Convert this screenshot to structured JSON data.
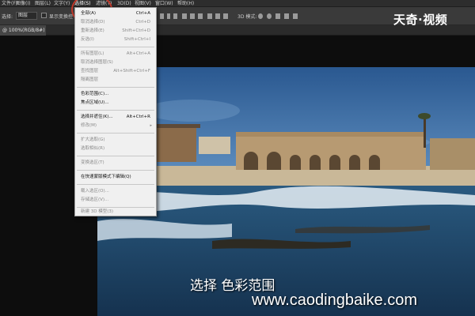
{
  "menubar": {
    "items": [
      "文件(F)",
      "图像(I)",
      "图层(L)",
      "文字(Y)",
      "选择(S)",
      "滤镜(T)",
      "3D(D)",
      "视图(V)",
      "窗口(W)",
      "帮助(H)"
    ]
  },
  "options_bar": {
    "select_label": "选择:",
    "layer_value": "图层",
    "checkbox_label": "显示变换控件",
    "mode_3d_label": "3D 模式:"
  },
  "tab": {
    "label": "@ 100%(RGB/8#)"
  },
  "select_menu": {
    "items": [
      {
        "label": "全部(A)",
        "shortcut": "Ctrl+A",
        "enabled": true
      },
      {
        "label": "取消选择(D)",
        "shortcut": "Ctrl+D",
        "enabled": false
      },
      {
        "label": "重新选择(E)",
        "shortcut": "Shift+Ctrl+D",
        "enabled": false
      },
      {
        "label": "反选(I)",
        "shortcut": "Shift+Ctrl+I",
        "enabled": false
      },
      {
        "label": "所有图层(L)",
        "shortcut": "Alt+Ctrl+A",
        "enabled": false
      },
      {
        "label": "取消选择图层(S)",
        "shortcut": "",
        "enabled": false
      },
      {
        "label": "查找图层",
        "shortcut": "Alt+Shift+Ctrl+F",
        "enabled": false
      },
      {
        "label": "隔离图层",
        "shortcut": "",
        "enabled": false
      },
      {
        "label": "色彩范围(C)...",
        "shortcut": "",
        "enabled": true
      },
      {
        "label": "焦点区域(U)...",
        "shortcut": "",
        "enabled": true
      },
      {
        "label": "选择并遮住(K)...",
        "shortcut": "Alt+Ctrl+R",
        "enabled": true
      },
      {
        "label": "修改(M)",
        "shortcut": "",
        "enabled": false,
        "submenu": true
      },
      {
        "label": "扩大选取(G)",
        "shortcut": "",
        "enabled": false
      },
      {
        "label": "选取相似(R)",
        "shortcut": "",
        "enabled": false
      },
      {
        "label": "变换选区(T)",
        "shortcut": "",
        "enabled": false
      },
      {
        "label": "在快速蒙版模式下编辑(Q)",
        "shortcut": "",
        "enabled": true
      },
      {
        "label": "载入选区(O)...",
        "shortcut": "",
        "enabled": false
      },
      {
        "label": "存储选区(V)...",
        "shortcut": "",
        "enabled": false
      },
      {
        "label": "新建 3D 模型(3)",
        "shortcut": "",
        "enabled": false
      }
    ]
  },
  "logo_text": "天奇·视频",
  "caption": "选择 色彩范围",
  "url": "www.caodingbaike.com",
  "colors": {
    "annotation_circle": "#c0392b",
    "menu_bg": "#f0f0f0",
    "sky": "#2f5f95",
    "sea": "#1f4668"
  }
}
